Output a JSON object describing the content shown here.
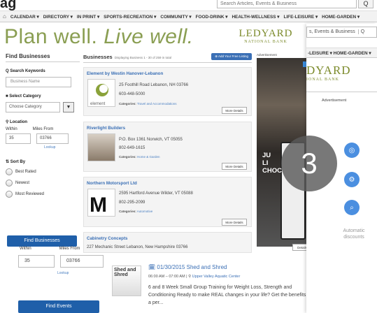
{
  "top_search": {
    "placeholder": "Search Articles, Events & Business",
    "button": "Q"
  },
  "logo_partial": "ag",
  "nav": {
    "home_icon": "home-icon",
    "items": [
      "CALENDAR ▾",
      "DIRECTORY ▾",
      "IN PRINT ▾",
      "SPORTS-RECREATION ▾",
      "COMMUNITY ▾",
      "FOOD-DRINK ▾",
      "HEALTH-WELLNESS ▾",
      "LIFE-LEISURE ▾",
      "HOME-GARDEN ▾"
    ]
  },
  "banner": {
    "slogan_a": "Plan well.",
    "slogan_b": "Live well.",
    "ledyard_big": "LEDYARD",
    "ledyard_small": "NATIONAL BANK"
  },
  "sidebar": {
    "title": "Find Businesses",
    "search_label": "Q Search Keywords",
    "search_placeholder": "Business Name",
    "category_label": "■ Select Category",
    "category_value": "Choose Category",
    "location_label": "⚲ Location",
    "within_label": "Within",
    "miles_label": "Miles From",
    "within_value": "35",
    "zip_value": "03766",
    "lookup": "Lookup",
    "sort_label": "⇅ Sort By",
    "sort_options": [
      "Best Rated",
      "Newest",
      "Most Reviewed"
    ],
    "find_button": "Find Businesses"
  },
  "main": {
    "title": "Businesses",
    "count_text": "Displaying Business 1 - 30 of 259 in total",
    "add_button": "⊕ Add Your Free Listing",
    "listings": [
      {
        "name": "Element by Westin Hanover-Lebanon",
        "addr": "25 Foothill Road Lebanon, NH 03766",
        "phone": "603-448-5000",
        "cat_label": "Categories:",
        "cat": "Travel and Accommodations",
        "more": "More Details",
        "thumb_text": "element"
      },
      {
        "name": "Riverlight Builders",
        "addr": "P.O. Box 1361 Norwich, VT 05055",
        "phone": "802-649-1615",
        "cat_label": "Categories:",
        "cat": "Home & Garden",
        "more": "More Details",
        "thumb_text": ""
      },
      {
        "name": "Northern Motorsport Ltd",
        "addr": "2595 Hartford Avenue Wilder, VT 05088",
        "phone": "802-295-2099",
        "cat_label": "Categories:",
        "cat": "Automotive",
        "more": "More Details",
        "thumb_text": "M"
      },
      {
        "name": "Cabinetry Concepts",
        "addr": "227 Mechanic Street Lebanon, New Hampshire 03766",
        "phone": "",
        "cat_label": "Categories:",
        "cat": "Home & Garden",
        "more": "Details",
        "thumb_text": ""
      }
    ]
  },
  "ads": {
    "label": "Advertisement",
    "ad_text": "JU\nLI\nCHOC"
  },
  "overlay": {
    "search_text": "s, Events & Business",
    "search_btn": "Q",
    "nav_text": "-LEISURE ▾  HOME-GARDEN ▾",
    "ledyard_big": "DYARD",
    "ledyard_small": "IONAL BANK",
    "ad_label": "Advertisement",
    "auto_text": "Automatic discounts"
  },
  "step_badge": "3",
  "lower": {
    "within_label": "Within",
    "miles_label": "Miles From",
    "within_value": "35",
    "zip_value": "03766",
    "lookup": "Lookup",
    "find_events": "Find Events",
    "details_btn": "Details",
    "event": {
      "thumb_text": "Shed and Shred",
      "date_title": "🗓 01/30/2015 Shed and Shred",
      "meta_time": "06:00 AM – 07:00 AM | ⚲",
      "meta_place": "Upper Valley Aquatic Center",
      "desc": "6 and 8 Week Small Group Training for Weight Loss, Strength and Conditioning Ready to make REAL changes in your life? Get the benefits of a per..."
    }
  }
}
